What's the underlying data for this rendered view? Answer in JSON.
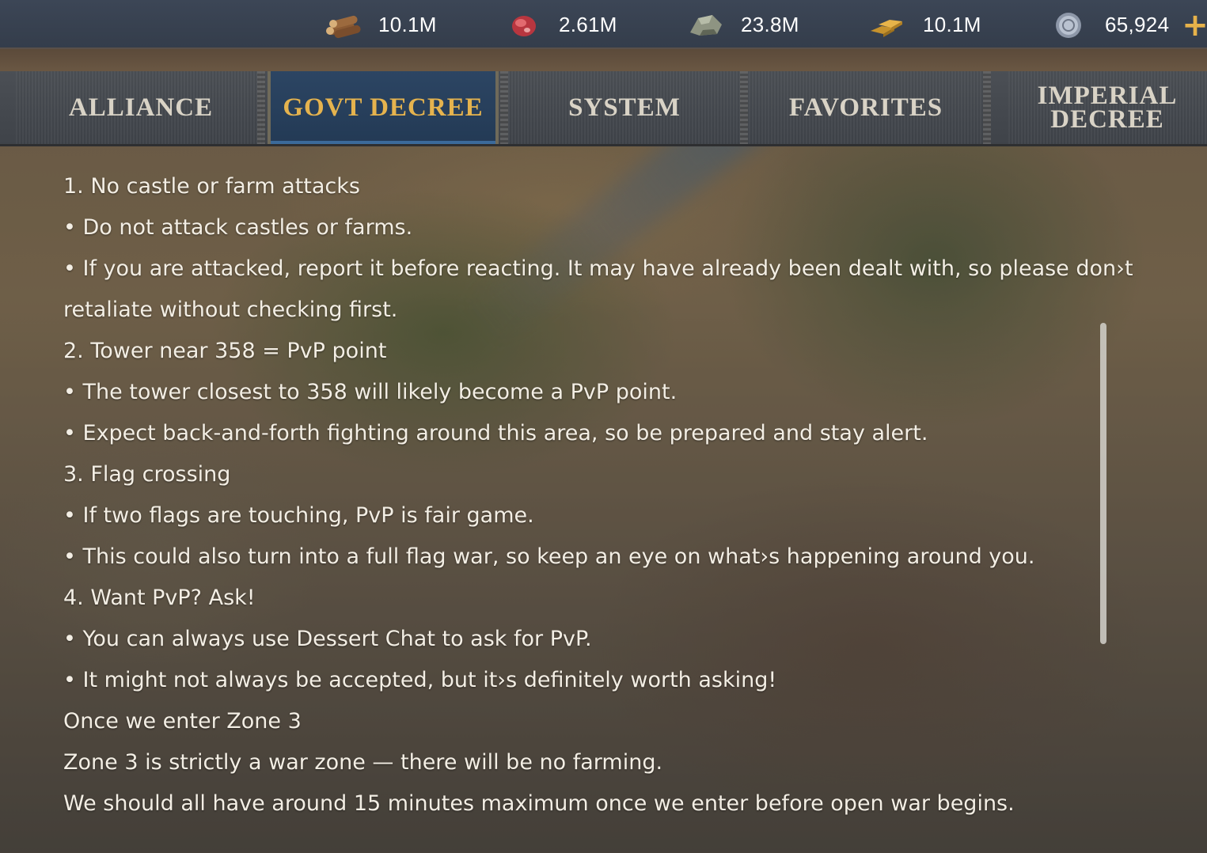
{
  "resources": [
    {
      "icon": "wood-icon",
      "value": "10.1M"
    },
    {
      "icon": "food-meat-icon",
      "value": "2.61M"
    },
    {
      "icon": "stone-icon",
      "value": "23.8M"
    },
    {
      "icon": "gold-icon",
      "value": "10.1M"
    },
    {
      "icon": "gem-coin-icon",
      "value": "65,924"
    }
  ],
  "plus_label": "+",
  "tabs": [
    {
      "label": "ALLIANCE",
      "active": false
    },
    {
      "label": "GOVT DECREE",
      "active": true
    },
    {
      "label": "SYSTEM",
      "active": false
    },
    {
      "label": "FAVORITES",
      "active": false
    },
    {
      "label": "IMPERIAL DECREE",
      "active": false
    }
  ],
  "decree_lines": [
    "1. No castle or farm attacks",
    "• Do not attack castles or farms.",
    "• If you are attacked, report it before reacting. It may have already been dealt with, so please don›t",
    "retaliate without checking first.",
    "2. Tower near 358 = PvP point",
    "• The tower closest to 358 will likely become a PvP point.",
    "• Expect back-and-forth fighting around this area, so be prepared and stay alert.",
    "3. Flag crossing",
    "• If two flags are touching, PvP is fair game.",
    "• This could also turn into a full flag war, so keep an eye on what›s happening around you.",
    "4. Want PvP? Ask!",
    "• You can always use Dessert Chat to ask for PvP.",
    "• It might not always be accepted, but it›s definitely worth asking!",
    "Once we enter Zone 3",
    "Zone 3 is strictly a war zone — there will be no farming.",
    "We should all have around 15 minutes maximum once we enter before open war begins."
  ]
}
